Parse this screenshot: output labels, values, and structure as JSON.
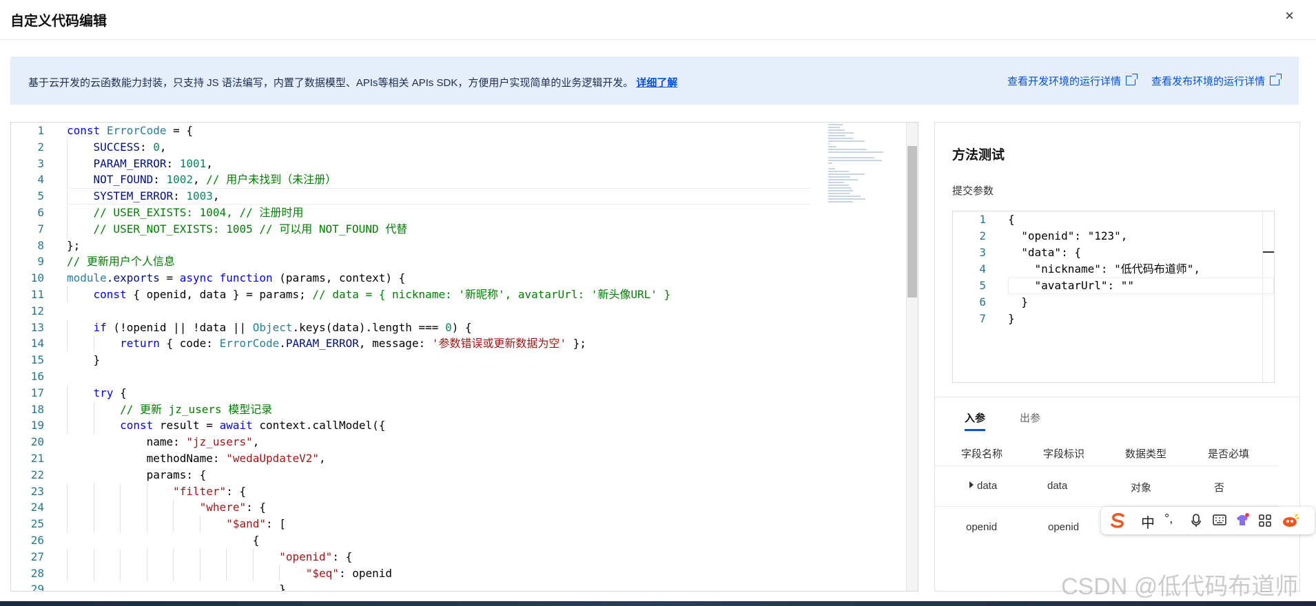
{
  "window": {
    "title": "自定义代码编辑",
    "close_glyph": "×"
  },
  "banner": {
    "text": "基于云开发的云函数能力封装，只支持 JS 语法编写，内置了数据模型、APIs等相关 APIs SDK，方便用户实现简单的业务逻辑开发。",
    "learn_more": "详细了解",
    "dev_link": "查看开发环境的运行详情",
    "prod_link": "查看发布环境的运行详情"
  },
  "editor": {
    "lines": [
      [
        [
          "k",
          "const"
        ],
        [
          "f",
          " "
        ],
        [
          "t",
          "ErrorCode"
        ],
        [
          "f",
          " = {"
        ]
      ],
      [
        [
          "f",
          "    "
        ],
        [
          "p",
          "SUCCESS"
        ],
        [
          "f",
          ": "
        ],
        [
          "n",
          "0"
        ],
        [
          "f",
          ","
        ]
      ],
      [
        [
          "f",
          "    "
        ],
        [
          "p",
          "PARAM_ERROR"
        ],
        [
          "f",
          ": "
        ],
        [
          "n",
          "1001"
        ],
        [
          "f",
          ","
        ]
      ],
      [
        [
          "f",
          "    "
        ],
        [
          "p",
          "NOT_FOUND"
        ],
        [
          "f",
          ": "
        ],
        [
          "n",
          "1002"
        ],
        [
          "f",
          ", "
        ],
        [
          "c",
          "// 用户未找到（未注册）"
        ]
      ],
      [
        [
          "f",
          "    "
        ],
        [
          "p",
          "SYSTEM_ERROR"
        ],
        [
          "f",
          ": "
        ],
        [
          "n",
          "1003"
        ],
        [
          "f",
          ","
        ]
      ],
      [
        [
          "f",
          "    "
        ],
        [
          "c",
          "// USER_EXISTS: 1004, // 注册时用"
        ]
      ],
      [
        [
          "f",
          "    "
        ],
        [
          "c",
          "// USER_NOT_EXISTS: 1005 // 可以用 NOT_FOUND 代替"
        ]
      ],
      [
        [
          "f",
          "};"
        ]
      ],
      [
        [
          "c",
          "// 更新用户个人信息"
        ]
      ],
      [
        [
          "t",
          "module"
        ],
        [
          "f",
          "."
        ],
        [
          "p",
          "exports"
        ],
        [
          "f",
          " = "
        ],
        [
          "k",
          "async"
        ],
        [
          "f",
          " "
        ],
        [
          "k",
          "function"
        ],
        [
          "f",
          " (params, context) {"
        ]
      ],
      [
        [
          "f",
          "    "
        ],
        [
          "k",
          "const"
        ],
        [
          "f",
          " { openid, data } = params; "
        ],
        [
          "c",
          "// data = { nickname: '新昵称', avatarUrl: '新头像URL' }"
        ]
      ],
      [
        [
          "f",
          ""
        ]
      ],
      [
        [
          "f",
          "    "
        ],
        [
          "k",
          "if"
        ],
        [
          "f",
          " (!openid || !data || "
        ],
        [
          "t",
          "Object"
        ],
        [
          "f",
          ".keys(data).length === "
        ],
        [
          "n",
          "0"
        ],
        [
          "f",
          ") {"
        ]
      ],
      [
        [
          "f",
          "        "
        ],
        [
          "k",
          "return"
        ],
        [
          "f",
          " { code: "
        ],
        [
          "t",
          "ErrorCode"
        ],
        [
          "f",
          "."
        ],
        [
          "p",
          "PARAM_ERROR"
        ],
        [
          "f",
          ", message: "
        ],
        [
          "s",
          "'参数错误或更新数据为空'"
        ],
        [
          "f",
          " };"
        ]
      ],
      [
        [
          "f",
          "    }"
        ]
      ],
      [
        [
          "f",
          ""
        ]
      ],
      [
        [
          "f",
          "    "
        ],
        [
          "k",
          "try"
        ],
        [
          "f",
          " {"
        ]
      ],
      [
        [
          "f",
          "        "
        ],
        [
          "c",
          "// 更新 jz_users 模型记录"
        ]
      ],
      [
        [
          "f",
          "        "
        ],
        [
          "k",
          "const"
        ],
        [
          "f",
          " result = "
        ],
        [
          "k",
          "await"
        ],
        [
          "f",
          " context.callModel({"
        ]
      ],
      [
        [
          "f",
          "            name: "
        ],
        [
          "s",
          "\"jz_users\""
        ],
        [
          "f",
          ","
        ]
      ],
      [
        [
          "f",
          "            methodName: "
        ],
        [
          "s",
          "\"wedaUpdateV2\""
        ],
        [
          "f",
          ","
        ]
      ],
      [
        [
          "f",
          "            params: {"
        ]
      ],
      [
        [
          "f",
          "                "
        ],
        [
          "s",
          "\"filter\""
        ],
        [
          "f",
          ": {"
        ]
      ],
      [
        [
          "f",
          "                    "
        ],
        [
          "s",
          "\"where\""
        ],
        [
          "f",
          ": {"
        ]
      ],
      [
        [
          "f",
          "                        "
        ],
        [
          "s",
          "\"$and\""
        ],
        [
          "f",
          ": ["
        ]
      ],
      [
        [
          "f",
          "                            {"
        ]
      ],
      [
        [
          "f",
          "                                "
        ],
        [
          "s",
          "\"openid\""
        ],
        [
          "f",
          ": {"
        ]
      ],
      [
        [
          "f",
          "                                    "
        ],
        [
          "s",
          "\"$eq\""
        ],
        [
          "f",
          ": openid"
        ]
      ],
      [
        [
          "f",
          "                                }"
        ]
      ]
    ]
  },
  "test_panel": {
    "title": "方法测试",
    "params_label": "提交参数",
    "json_lines": [
      "{",
      "  \"openid\": \"123\",",
      "  \"data\": {",
      "    \"nickname\": \"低代码布道师\",",
      "    \"avatarUrl\": \"\"",
      "  }",
      "}"
    ],
    "tabs": [
      "入参",
      "出参"
    ],
    "columns": [
      "字段名称",
      "字段标识",
      "数据类型",
      "是否必填"
    ],
    "rows": [
      [
        "data",
        "data",
        "对象",
        "否"
      ],
      [
        "openid",
        "openid",
        "",
        ""
      ]
    ]
  },
  "ime": {
    "lang": "中",
    "punct": "°,"
  },
  "watermark": "CSDN @低代码布道师"
}
